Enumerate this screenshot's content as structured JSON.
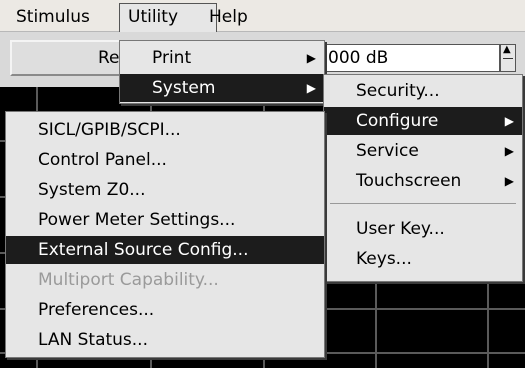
{
  "menubar": {
    "items": [
      "Stimulus",
      "Utility",
      "Help"
    ]
  },
  "background": {
    "field_label_fragment": "Re",
    "value_fragment": ").000 dB"
  },
  "utility_menu": {
    "items": [
      {
        "label": "Print",
        "has_submenu": true,
        "selected": false
      },
      {
        "label": "System",
        "has_submenu": true,
        "selected": true
      }
    ]
  },
  "system_menu": {
    "items": [
      {
        "label": "Security...",
        "has_submenu": false,
        "selected": false
      },
      {
        "label": "Configure",
        "has_submenu": true,
        "selected": true
      },
      {
        "label": "Service",
        "has_submenu": true,
        "selected": false
      },
      {
        "label": "Touchscreen",
        "has_submenu": true,
        "selected": false
      },
      {
        "label": "User Key...",
        "has_submenu": false,
        "selected": false
      },
      {
        "label": "Keys...",
        "has_submenu": false,
        "selected": false
      }
    ]
  },
  "configure_menu": {
    "items": [
      {
        "label": "SICL/GPIB/SCPI...",
        "enabled": true,
        "selected": false
      },
      {
        "label": "Control Panel...",
        "enabled": true,
        "selected": false
      },
      {
        "label": "System Z0...",
        "enabled": true,
        "selected": false
      },
      {
        "label": "Power Meter Settings...",
        "enabled": true,
        "selected": false
      },
      {
        "label": "External Source Config...",
        "enabled": true,
        "selected": true
      },
      {
        "label": "Multiport Capability...",
        "enabled": false,
        "selected": false
      },
      {
        "label": "Preferences...",
        "enabled": true,
        "selected": false
      },
      {
        "label": "LAN Status...",
        "enabled": true,
        "selected": false
      }
    ]
  },
  "colors": {
    "menu_bg": "#e6e6e6",
    "selection_bg": "#1c1c1c",
    "disabled_text": "#9a9a9a",
    "display_bg": "#000000"
  }
}
